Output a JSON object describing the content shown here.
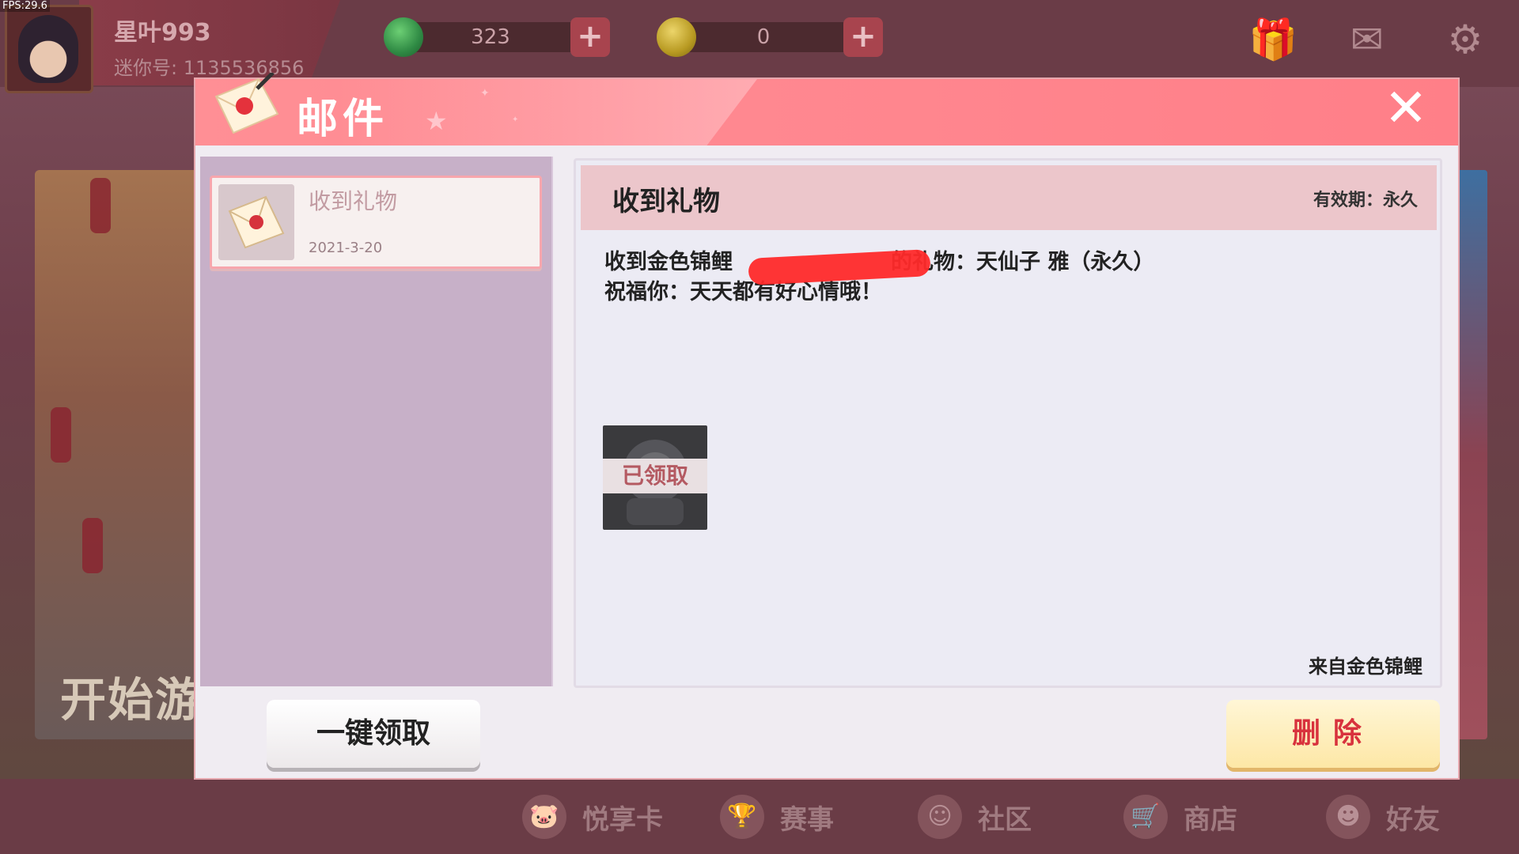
{
  "fps": "FPS:29.6",
  "player": {
    "name": "星叶993",
    "id_label": "迷你号: 1135536856"
  },
  "currencies": [
    {
      "name": "mini-bean",
      "value": "323",
      "color": "#2f8a44"
    },
    {
      "name": "mini-coin",
      "value": "0",
      "color": "#b89a22"
    }
  ],
  "top_icons": [
    "gift-icon",
    "mail-icon",
    "gear-icon"
  ],
  "background": {
    "start_text": "开始游"
  },
  "mail_dialog": {
    "title": "邮件",
    "close_label": "✕",
    "list": [
      {
        "title": "收到礼物",
        "date": "2021-3-20",
        "selected": true
      }
    ],
    "claim_all_label": "一键领取",
    "detail": {
      "title": "收到礼物",
      "validity_label": "有效期：",
      "validity_value": "永久",
      "line1_prefix": "收到金色锦鲤",
      "line1_suffix": "的礼物：天仙子 雅（永久）",
      "line2": "祝福你：天天都有好心情哦！",
      "reward_status": "已领取",
      "from": "来自金色锦鲤"
    },
    "delete_label": "删除"
  },
  "bottom_nav": [
    {
      "label": "悦享卡",
      "icon": "pig-icon"
    },
    {
      "label": "赛事",
      "icon": "trophy-icon"
    },
    {
      "label": "社区",
      "icon": "community-icon"
    },
    {
      "label": "商店",
      "icon": "cart-icon"
    },
    {
      "label": "好友",
      "icon": "friends-icon"
    }
  ],
  "colors": {
    "header": "#ff8a92",
    "delete_text": "#d8323d",
    "selected_card_border": "#f7a6ad"
  }
}
